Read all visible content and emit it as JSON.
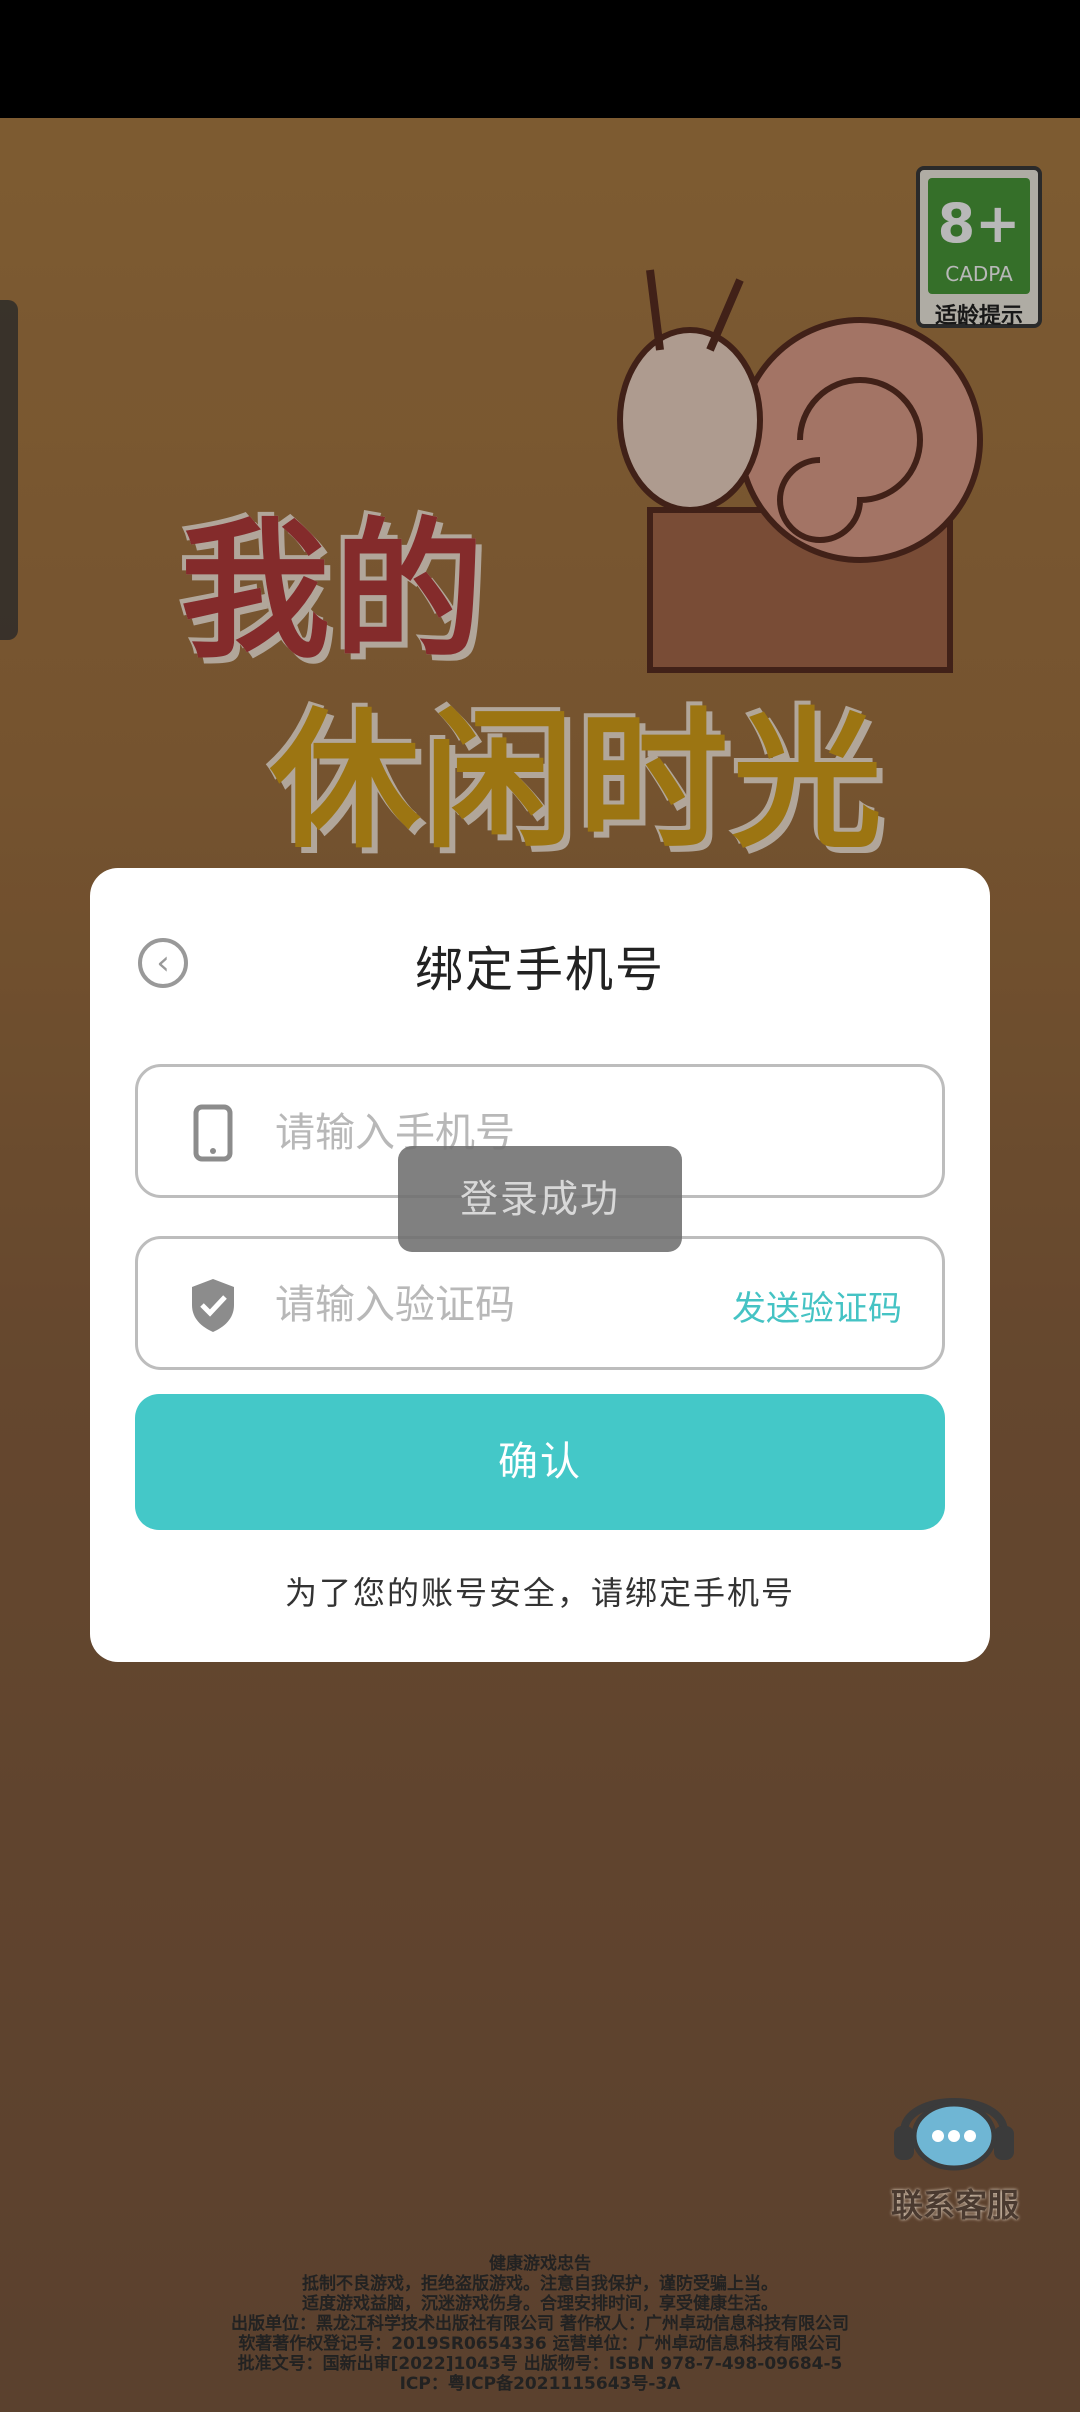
{
  "game": {
    "title_line1": "我的",
    "title_line2": "休闲时光"
  },
  "age_rating": {
    "value": "8+",
    "org": "CADPA",
    "tip": "适龄提示"
  },
  "dialog": {
    "title": "绑定手机号",
    "phone_placeholder": "请输入手机号",
    "code_placeholder": "请输入验证码",
    "send_code": "发送验证码",
    "confirm": "确认",
    "hint": "为了您的账号安全，请绑定手机号"
  },
  "toast": {
    "text": "登录成功"
  },
  "support": {
    "label": "联系客服"
  },
  "footer": {
    "lines": [
      "健康游戏忠告",
      "抵制不良游戏，拒绝盗版游戏。注意自我保护，谨防受骗上当。",
      "适度游戏益脑，沉迷游戏伤身。合理安排时间，享受健康生活。",
      "出版单位：黑龙江科学技术出版社有限公司   著作权人：广州卓动信息科技有限公司",
      "软著著作权登记号：2019SR0654336   运营单位：广州卓动信息科技有限公司",
      "批准文号：国新出审[2022]1043号   出版物号：ISBN 978-7-498-09684-5",
      "ICP：粤ICP备2021115643号-3A"
    ]
  },
  "colors": {
    "accent": "#44c8c8",
    "send_code": "#45c3c4"
  },
  "icons": {
    "back": "chevron-left-circle-icon",
    "phone": "phone-icon",
    "shield": "shield-check-icon",
    "support": "headset-chat-icon"
  }
}
